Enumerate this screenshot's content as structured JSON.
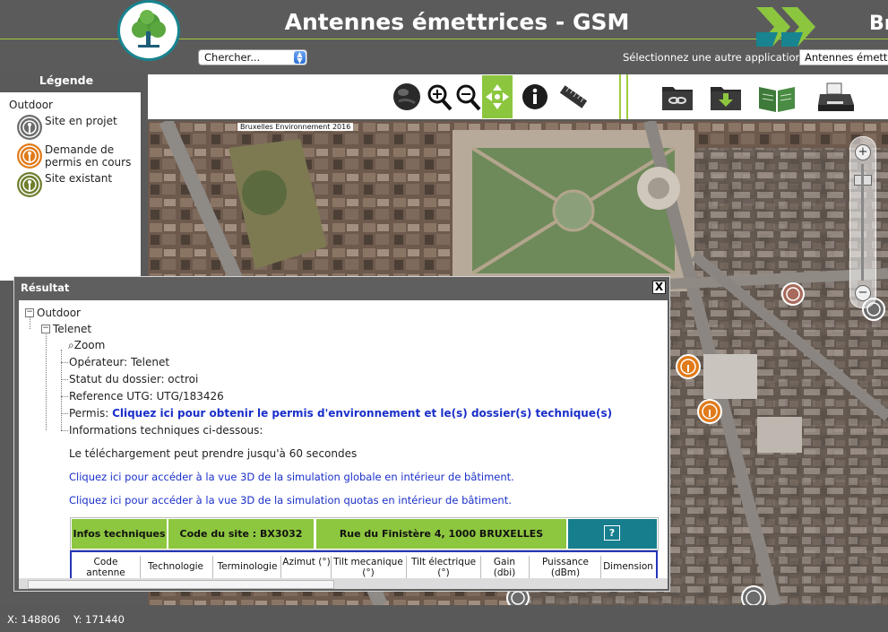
{
  "header": {
    "title": "Antennes émettrices - GSM",
    "brand_text": "Br",
    "search_select": "Chercher...",
    "other_app_label": "Sélectionnez une autre application",
    "other_app_value": "Antennes émettric",
    "colors": {
      "accent_green": "#9fcc3b",
      "teal": "#17848f",
      "header_bg": "#5b5b5b"
    }
  },
  "legend": {
    "title": "Légende",
    "category": "Outdoor",
    "items": [
      {
        "label": "Site en projet",
        "icon": "antenna-grey-icon",
        "color": "#6c6c6c"
      },
      {
        "label": "Demande de permis en cours",
        "icon": "antenna-orange-icon",
        "color": "#e07b1a"
      },
      {
        "label": "Site existant",
        "icon": "antenna-green-icon",
        "color": "#6f7f2e"
      }
    ]
  },
  "toolbar": {
    "tools": [
      "globe-icon",
      "zoom-in-icon",
      "zoom-out-icon",
      "pan-icon",
      "info-icon",
      "measure-ruler-icon",
      "link-folder-icon",
      "download-folder-icon",
      "book-icon",
      "print-icon"
    ],
    "active_tool": "pan-icon"
  },
  "map": {
    "attribution": "Bruxelles Environnement 2016",
    "zoom_plus": "+",
    "zoom_minus": "−"
  },
  "status": {
    "x": "X: 148806",
    "y": "Y: 171440"
  },
  "result": {
    "title": "Résultat",
    "close": "X",
    "tree": {
      "root": "Outdoor",
      "operator_node": "Telenet",
      "zoom": "Zoom",
      "operateur": "Opérateur: Telenet",
      "statut": "Statut du dossier: octroi",
      "reference": "Reference UTG: UTG/183426",
      "permis_label": "Permis:",
      "permis_link": "Cliquez ici pour obtenir le permis d'environnement et le(s) dossier(s) technique(s)",
      "infos": "Informations techniques ci-dessous:"
    },
    "download_note": "Le téléchargement peut prendre jusqu'à 60 secondes",
    "link_3d_global": "Cliquez ici pour accéder à la vue 3D de la simulation globale en intérieur de bâtiment.",
    "link_3d_quotas": "Cliquez ici pour accéder à la vue 3D de la simulation quotas en intérieur de bâtiment.",
    "info_bar": {
      "infos_techniques": "Infos techniques",
      "code_site": "Code du site : BX3032",
      "adresse": "Rue du Finistère 4, 1000 BRUXELLES",
      "help": "?"
    },
    "table_headers": [
      "Code antenne",
      "Technologie",
      "Terminologie",
      "Azimut (°)",
      "Tilt mecanique (°)",
      "Tilt électrique (°)",
      "Gain (dbi)",
      "Puissance (dBm)",
      "Dimension"
    ]
  }
}
